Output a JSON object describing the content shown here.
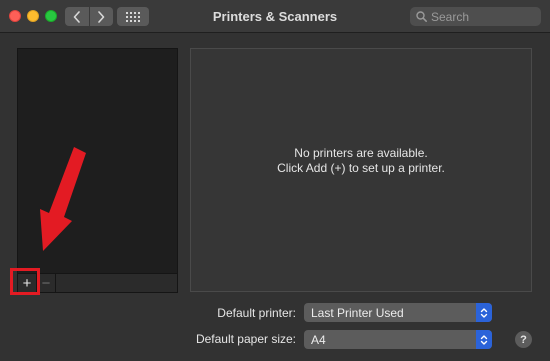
{
  "window": {
    "title": "Printers & Scanners"
  },
  "search": {
    "placeholder": "Search",
    "value": ""
  },
  "printer_list": {
    "items": [],
    "add_label": "+",
    "remove_label": "−"
  },
  "detail": {
    "empty_line1": "No printers are available.",
    "empty_line2": "Click Add (+) to set up a printer."
  },
  "settings": {
    "default_printer_label": "Default printer:",
    "default_printer_value": "Last Printer Used",
    "default_paper_label": "Default paper size:",
    "default_paper_value": "A4"
  },
  "help_label": "?",
  "icons": {
    "back": "chevron-left-icon",
    "forward": "chevron-right-icon",
    "grid": "grid-icon",
    "search": "search-icon",
    "stepper": "stepper-icon",
    "annotation_arrow": "arrow-icon"
  },
  "colors": {
    "accent": "#2b63d9",
    "annotation_red": "#e31b23",
    "close": "#fe5f57",
    "minimize": "#febc2e",
    "zoom": "#28c840"
  }
}
